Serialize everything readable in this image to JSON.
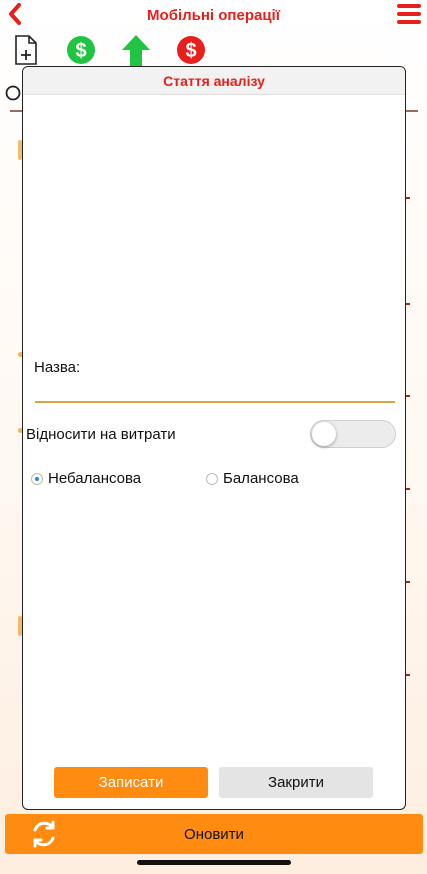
{
  "app": {
    "title": "Мобільні операції"
  },
  "dialog": {
    "title": "Стаття аналізу",
    "name_label": "Назва:",
    "name_value": "",
    "expense_label": "Відносити на витрати",
    "expense_toggle_on": false,
    "radio_options": [
      {
        "label": "Небалансова",
        "checked": true
      },
      {
        "label": "Балансова",
        "checked": false
      }
    ],
    "save_label": "Записати",
    "close_label": "Закрити"
  },
  "footer": {
    "refresh_label": "Оновити"
  },
  "icons": {
    "back": "chevron-left-icon",
    "menu": "hamburger-menu-icon",
    "new_doc": "new-document-icon",
    "income": "dollar-green-icon",
    "upload": "arrow-up-icon",
    "expense": "dollar-red-icon",
    "refresh": "refresh-icon"
  },
  "colors": {
    "accent_red": "#e8201c",
    "accent_orange": "#ff8c10",
    "accent_green": "#21c442",
    "input_underline": "#d9a441"
  }
}
